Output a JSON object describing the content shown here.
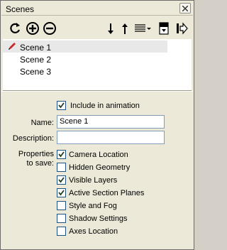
{
  "window": {
    "title": "Scenes"
  },
  "toolbar": {
    "buttons": [
      {
        "name": "update-scene",
        "icon": "refresh-icon"
      },
      {
        "name": "add-scene",
        "icon": "plus-circle-icon"
      },
      {
        "name": "remove-scene",
        "icon": "minus-circle-icon"
      },
      {
        "name": "move-scene-down",
        "icon": "arrow-down-icon"
      },
      {
        "name": "move-scene-up",
        "icon": "arrow-up-icon"
      },
      {
        "name": "view-options",
        "icon": "list-view-icon"
      },
      {
        "name": "show-details",
        "icon": "details-toggle-icon"
      },
      {
        "name": "expand-panel",
        "icon": "expand-arrow-icon"
      }
    ]
  },
  "scenes": {
    "items": [
      {
        "label": "Scene 1",
        "selected": true
      },
      {
        "label": "Scene 2",
        "selected": false
      },
      {
        "label": "Scene 3",
        "selected": false
      }
    ]
  },
  "properties": {
    "include_label": "Include in animation",
    "include_checked": true,
    "name_label": "Name:",
    "name_value": "Scene 1",
    "description_label": "Description:",
    "description_value": "",
    "save_label_line1": "Properties",
    "save_label_line2": "to save:",
    "save_options": [
      {
        "label": "Camera Location",
        "checked": true
      },
      {
        "label": "Hidden Geometry",
        "checked": false
      },
      {
        "label": "Visible Layers",
        "checked": true
      },
      {
        "label": "Active Section Planes",
        "checked": true
      },
      {
        "label": "Style and Fog",
        "checked": false
      },
      {
        "label": "Shadow Settings",
        "checked": false
      },
      {
        "label": "Axes Location",
        "checked": false
      }
    ]
  },
  "colors": {
    "background": "#ece9d8",
    "list_background": "#ffffff",
    "selected_row": "#e8e8e8",
    "checkbox_border": "#1c5180",
    "field_border": "#7f9db9"
  }
}
